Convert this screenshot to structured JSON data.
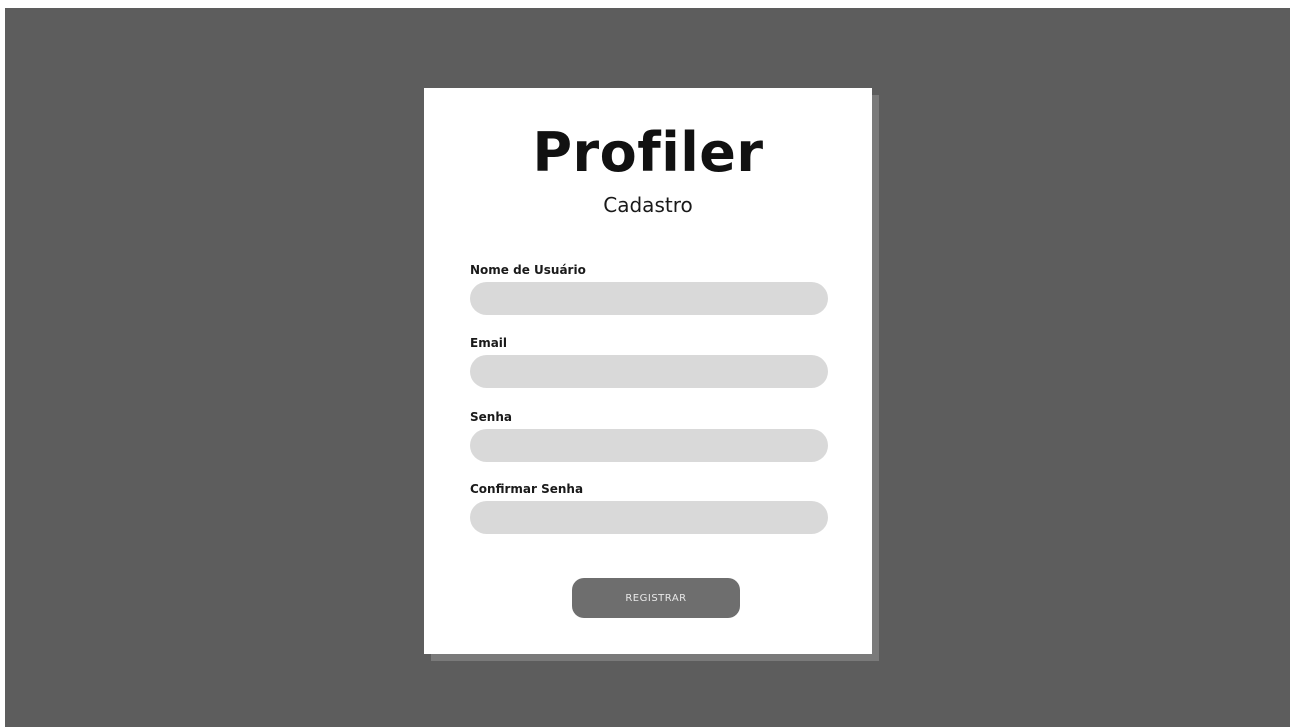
{
  "app": {
    "title": "Profiler",
    "subtitle": "Cadastro"
  },
  "form": {
    "fields": [
      {
        "label": "Nome de Usuário",
        "value": "",
        "placeholder": ""
      },
      {
        "label": "Email",
        "value": "",
        "placeholder": ""
      },
      {
        "label": "Senha",
        "value": "",
        "placeholder": ""
      },
      {
        "label": "Confirmar Senha",
        "value": "",
        "placeholder": ""
      }
    ],
    "submit_label": "REGISTRAR"
  },
  "colors": {
    "background": "#5d5d5d",
    "card": "#ffffff",
    "input": "#d9d9d9",
    "button": "#6e6e6e"
  }
}
